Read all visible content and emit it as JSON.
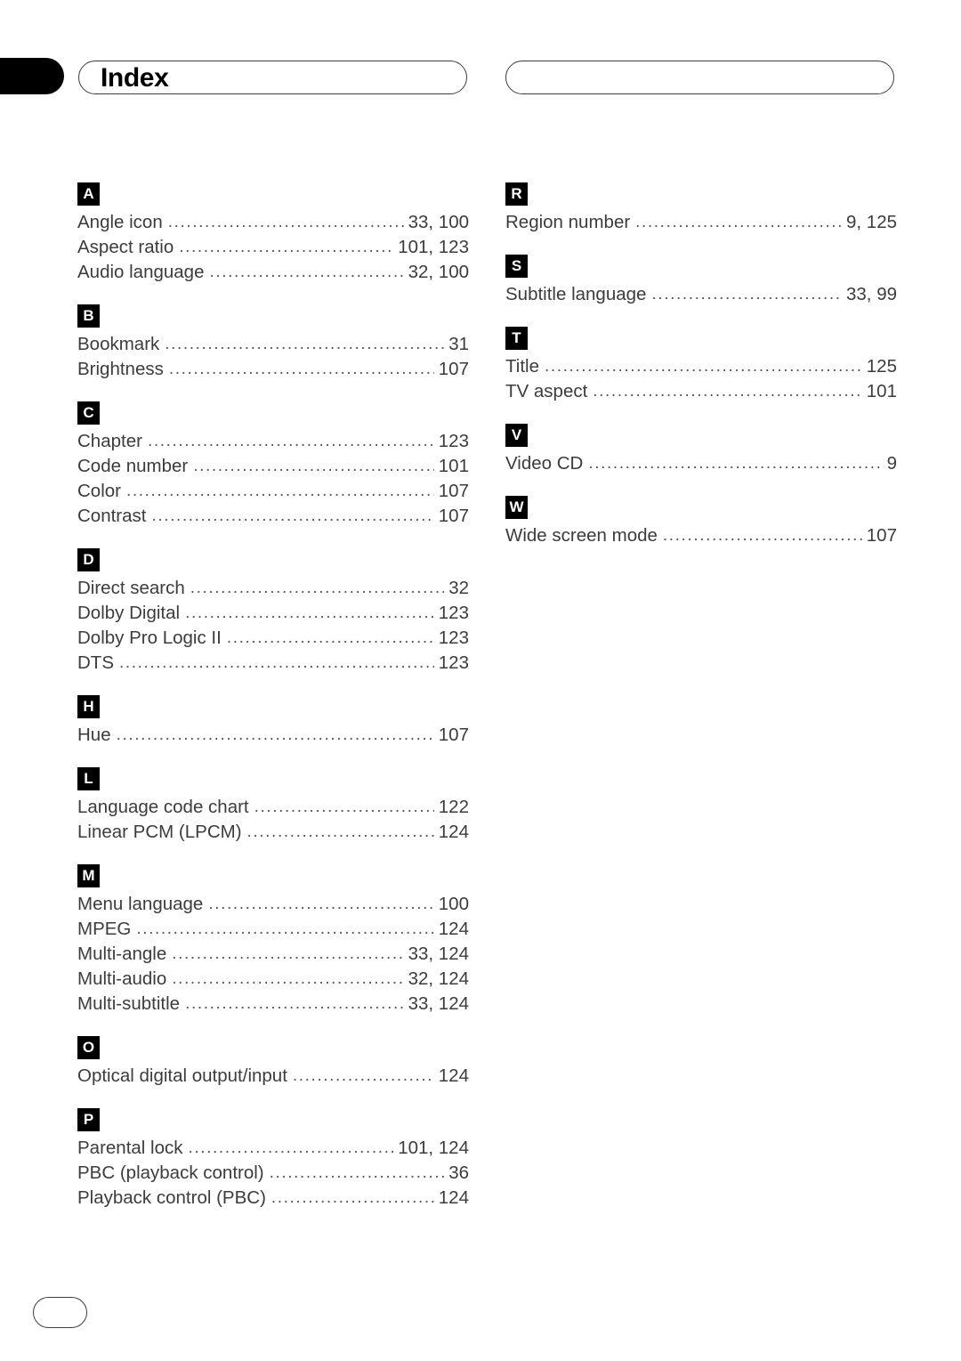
{
  "page": {
    "title": "Index",
    "footer_page_label": ""
  },
  "header": {
    "left_pill_title": "Index",
    "right_pill_title": ""
  },
  "columns": [
    {
      "name": "left-column",
      "sections": [
        {
          "letter": "A",
          "entries": [
            {
              "label": "Angle icon",
              "pages": "33, 100"
            },
            {
              "label": "Aspect ratio",
              "pages": "101, 123"
            },
            {
              "label": "Audio language",
              "pages": "32, 100"
            }
          ]
        },
        {
          "letter": "B",
          "entries": [
            {
              "label": "Bookmark",
              "pages": "31"
            },
            {
              "label": "Brightness",
              "pages": "107"
            }
          ]
        },
        {
          "letter": "C",
          "entries": [
            {
              "label": "Chapter",
              "pages": "123"
            },
            {
              "label": "Code number",
              "pages": "101"
            },
            {
              "label": "Color",
              "pages": "107"
            },
            {
              "label": "Contrast",
              "pages": "107"
            }
          ]
        },
        {
          "letter": "D",
          "entries": [
            {
              "label": "Direct search",
              "pages": "32"
            },
            {
              "label": "Dolby Digital",
              "pages": "123"
            },
            {
              "label": "Dolby Pro Logic II",
              "pages": "123"
            },
            {
              "label": "DTS",
              "pages": "123"
            }
          ]
        },
        {
          "letter": "H",
          "entries": [
            {
              "label": "Hue",
              "pages": "107"
            }
          ]
        },
        {
          "letter": "L",
          "entries": [
            {
              "label": "Language code chart",
              "pages": "122"
            },
            {
              "label": "Linear PCM (LPCM)",
              "pages": "124"
            }
          ]
        },
        {
          "letter": "M",
          "entries": [
            {
              "label": "Menu language",
              "pages": "100"
            },
            {
              "label": "MPEG",
              "pages": "124"
            },
            {
              "label": "Multi-angle",
              "pages": "33, 124"
            },
            {
              "label": "Multi-audio",
              "pages": "32, 124"
            },
            {
              "label": "Multi-subtitle",
              "pages": "33, 124"
            }
          ]
        },
        {
          "letter": "O",
          "entries": [
            {
              "label": "Optical digital output/input",
              "pages": "124"
            }
          ]
        },
        {
          "letter": "P",
          "entries": [
            {
              "label": "Parental lock",
              "pages": "101, 124"
            },
            {
              "label": "PBC (playback control)",
              "pages": "36"
            },
            {
              "label": "Playback control (PBC)",
              "pages": "124"
            }
          ]
        }
      ]
    },
    {
      "name": "right-column",
      "sections": [
        {
          "letter": "R",
          "entries": [
            {
              "label": "Region number",
              "pages": "9, 125"
            }
          ]
        },
        {
          "letter": "S",
          "entries": [
            {
              "label": "Subtitle language",
              "pages": "33, 99"
            }
          ]
        },
        {
          "letter": "T",
          "entries": [
            {
              "label": "Title",
              "pages": "125"
            },
            {
              "label": "TV aspect",
              "pages": "101"
            }
          ]
        },
        {
          "letter": "V",
          "entries": [
            {
              "label": "Video CD",
              "pages": "9"
            }
          ]
        },
        {
          "letter": "W",
          "entries": [
            {
              "label": "Wide screen mode",
              "pages": "107"
            }
          ]
        }
      ]
    }
  ]
}
